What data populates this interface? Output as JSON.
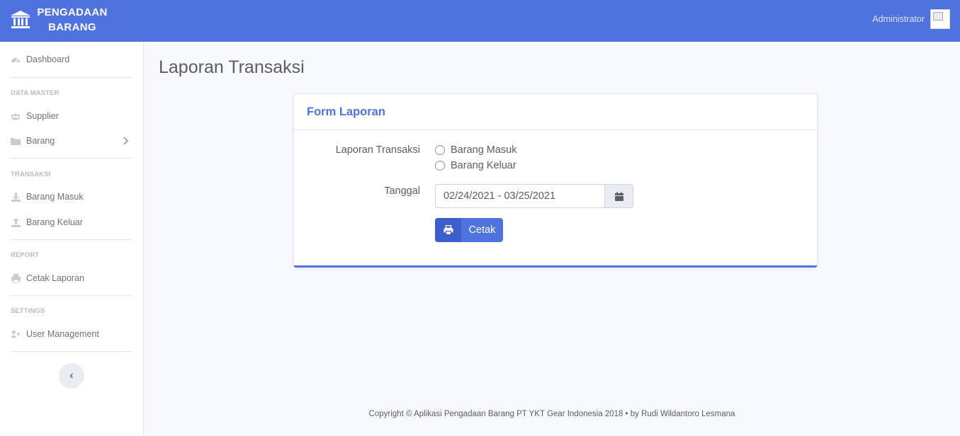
{
  "brand": {
    "line1": "PENGADAAN",
    "line2": "BARANG",
    "icon": "bank-icon"
  },
  "topbar": {
    "user_name": "Administrator",
    "avatar_icon": "broken-image-icon"
  },
  "sidebar": {
    "dashboard": "Dashboard",
    "heading_data_master": "DATA MASTER",
    "supplier": "Supplier",
    "barang": "Barang",
    "heading_transaksi": "TRANSAKSI",
    "barang_masuk": "Barang Masuk",
    "barang_keluar": "Barang Keluar",
    "heading_report": "REPORT",
    "cetak_laporan": "Cetak Laporan",
    "heading_settings": "SETTINGS",
    "user_management": "User Management"
  },
  "page": {
    "title": "Laporan Transaksi"
  },
  "form": {
    "card_title": "Form Laporan",
    "label_transaksi": "Laporan Transaksi",
    "option_masuk": "Barang Masuk",
    "option_keluar": "Barang Keluar",
    "label_tanggal": "Tanggal",
    "date_range": "02/24/2021 - 03/25/2021",
    "print_label": "Cetak"
  },
  "footer": {
    "text": "Copyright © Aplikasi Pengadaan Barang PT YKT Gear Indonesia 2018 • by Rudi Wildantoro Lesmana"
  },
  "colors": {
    "primary": "#4e73df",
    "sidebar_bg": "#ffffff",
    "page_bg": "#f8f9fc"
  }
}
